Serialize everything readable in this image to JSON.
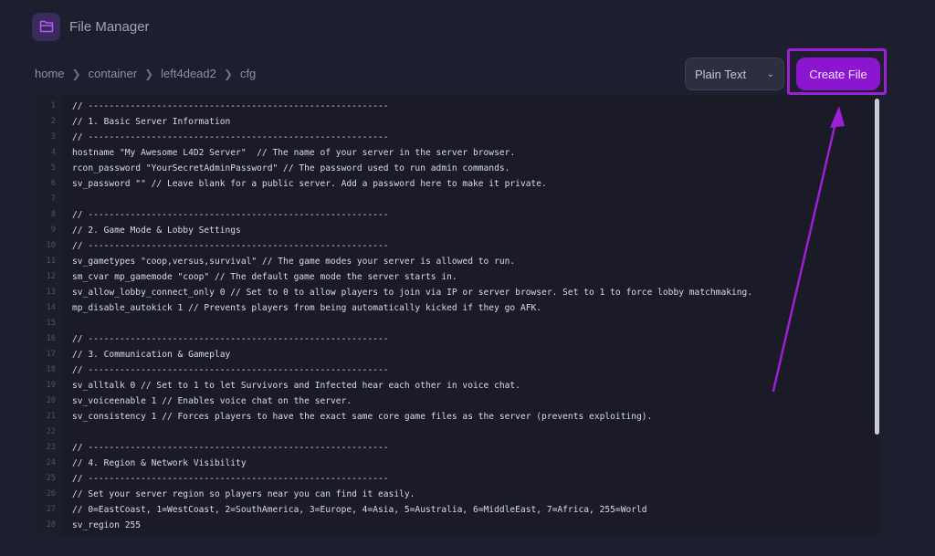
{
  "app": {
    "title": "File Manager",
    "icon": "folder-icon"
  },
  "breadcrumb": [
    "home",
    "container",
    "left4dead2",
    "cfg"
  ],
  "toolbar": {
    "language_select": "Plain Text",
    "create_file_label": "Create File"
  },
  "colors": {
    "accent": "#8c16cf",
    "annotation": "#9d1fd6"
  },
  "editor": {
    "lines": [
      {
        "n": "1",
        "text": "// ---------------------------------------------------------"
      },
      {
        "n": "2",
        "text": "// 1. Basic Server Information"
      },
      {
        "n": "3",
        "text": "// ---------------------------------------------------------"
      },
      {
        "n": "4",
        "text": "hostname \"My Awesome L4D2 Server\"  // The name of your server in the server browser."
      },
      {
        "n": "5",
        "text": "rcon_password \"YourSecretAdminPassword\" // The password used to run admin commands."
      },
      {
        "n": "6",
        "text": "sv_password \"\" // Leave blank for a public server. Add a password here to make it private."
      },
      {
        "n": "7",
        "text": ""
      },
      {
        "n": "8",
        "text": "// ---------------------------------------------------------"
      },
      {
        "n": "9",
        "text": "// 2. Game Mode & Lobby Settings"
      },
      {
        "n": "10",
        "text": "// ---------------------------------------------------------"
      },
      {
        "n": "11",
        "text": "sv_gametypes \"coop,versus,survival\" // The game modes your server is allowed to run."
      },
      {
        "n": "12",
        "text": "sm_cvar mp_gamemode \"coop\" // The default game mode the server starts in."
      },
      {
        "n": "13",
        "text": "sv_allow_lobby_connect_only 0 // Set to 0 to allow players to join via IP or server browser. Set to 1 to force lobby matchmaking."
      },
      {
        "n": "14",
        "text": "mp_disable_autokick 1 // Prevents players from being automatically kicked if they go AFK."
      },
      {
        "n": "15",
        "text": ""
      },
      {
        "n": "16",
        "text": "// ---------------------------------------------------------"
      },
      {
        "n": "17",
        "text": "// 3. Communication & Gameplay"
      },
      {
        "n": "18",
        "text": "// ---------------------------------------------------------"
      },
      {
        "n": "19",
        "text": "sv_alltalk 0 // Set to 1 to let Survivors and Infected hear each other in voice chat."
      },
      {
        "n": "20",
        "text": "sv_voiceenable 1 // Enables voice chat on the server."
      },
      {
        "n": "21",
        "text": "sv_consistency 1 // Forces players to have the exact same core game files as the server (prevents exploiting)."
      },
      {
        "n": "22",
        "text": ""
      },
      {
        "n": "23",
        "text": "// ---------------------------------------------------------"
      },
      {
        "n": "24",
        "text": "// 4. Region & Network Visibility"
      },
      {
        "n": "25",
        "text": "// ---------------------------------------------------------"
      },
      {
        "n": "26",
        "text": "// Set your server region so players near you can find it easily."
      },
      {
        "n": "27",
        "text": "// 0=EastCoast, 1=WestCoast, 2=SouthAmerica, 3=Europe, 4=Asia, 5=Australia, 6=MiddleEast, 7=Africa, 255=World"
      },
      {
        "n": "28",
        "text": "sv_region 255"
      }
    ]
  }
}
